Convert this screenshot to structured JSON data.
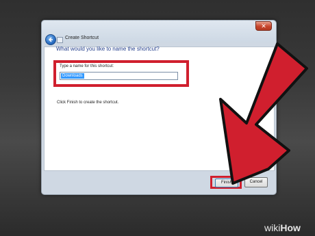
{
  "window": {
    "title": "Create Shortcut",
    "close_label": "✕"
  },
  "page": {
    "heading": "What would you like to name the shortcut?",
    "field_label": "Type a name for this shortcut:",
    "field_value": "Downloads",
    "info_text": "Click Finish to create the shortcut."
  },
  "buttons": {
    "finish": "Finish",
    "cancel": "Cancel"
  },
  "watermark": {
    "prefix": "wiki",
    "suffix": "How"
  },
  "colors": {
    "highlight": "#d01f2e",
    "heading": "#1f3b8a",
    "selection": "#3399ff"
  }
}
